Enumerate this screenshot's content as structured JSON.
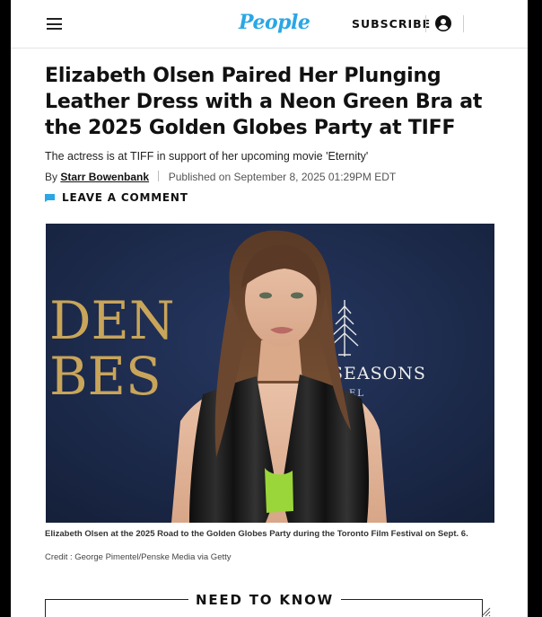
{
  "header": {
    "logo": "People",
    "subscribe_label": "SUBSCRIBE",
    "icons": {
      "menu": "hamburger-menu-icon",
      "account": "user-account-icon"
    },
    "brand_color": "#2aa7e5"
  },
  "article": {
    "headline": "Elizabeth Olsen Paired Her Plunging Leather Dress with a Neon Green Bra at the 2025 Golden Globes Party at TIFF",
    "dek": "The actress is at TIFF in support of her upcoming movie 'Eternity'",
    "byline_prefix": "By",
    "author": "Starr Bowenbank",
    "published": "Published on September 8, 2025 01:29PM EDT",
    "comment_label": "LEAVE A COMMENT",
    "comment_icon_color": "#2aa7e5"
  },
  "hero": {
    "backdrop_text_left_1": "DEN",
    "backdrop_text_left_2": "BES",
    "backdrop_text_right": "SEASONS",
    "backdrop_text_right_small": "EL",
    "backdrop_color": "#1a2744",
    "backdrop_gold": "#c9a55a"
  },
  "caption": {
    "text": "Elizabeth Olsen at the 2025 Road to the Golden Globes Party during the Toronto Film Festival on Sept. 6.",
    "credit": "Credit : George Pimentel/Penske Media via Getty"
  },
  "need_to_know": {
    "label": "NEED TO KNOW"
  }
}
